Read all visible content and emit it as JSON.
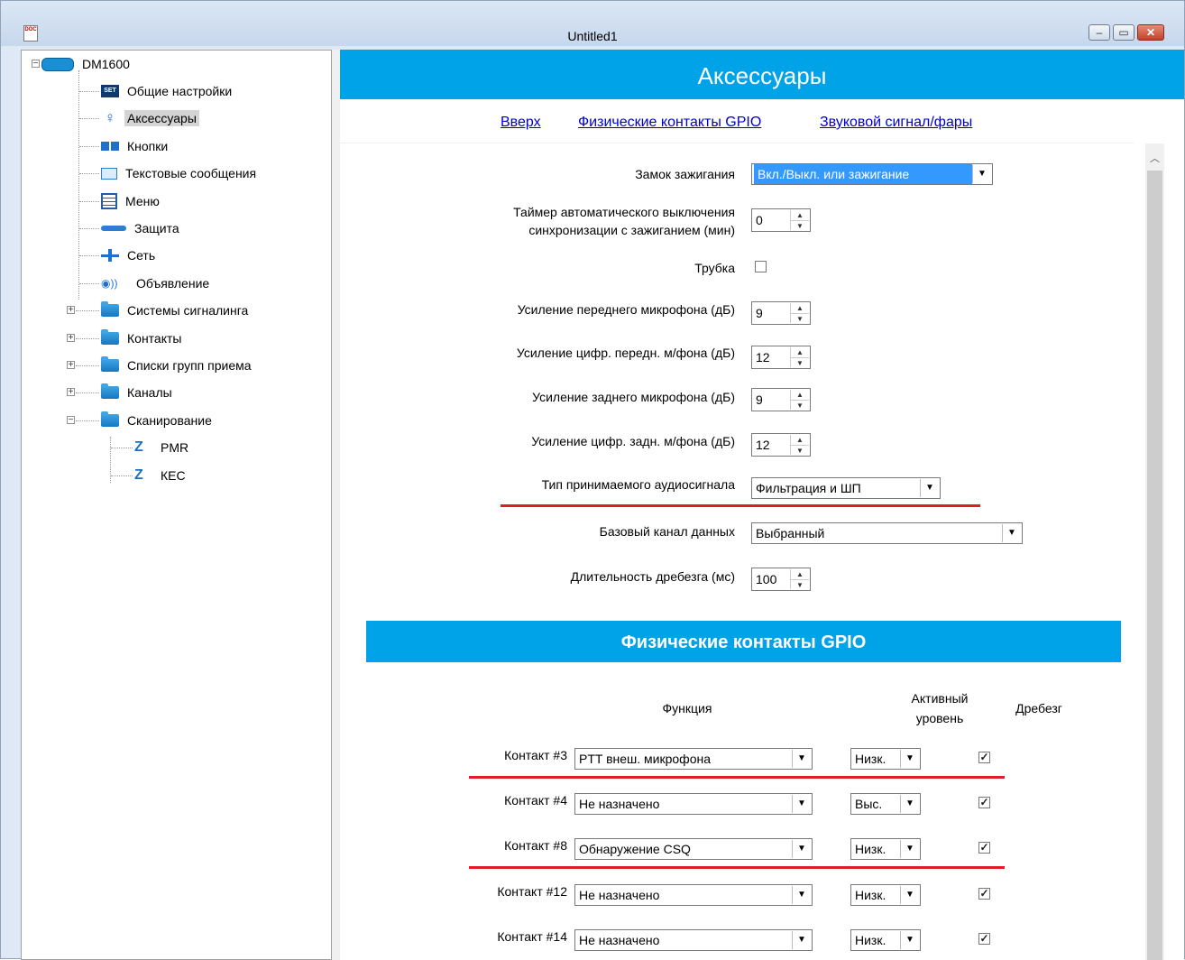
{
  "window": {
    "title": "Untitled1",
    "app_icon_text": "DOC",
    "buttons": [
      "minimize",
      "maximize",
      "close"
    ]
  },
  "tree": {
    "root": "DM1600",
    "items": [
      {
        "label": "Общие настройки",
        "icon": "settings-icon",
        "selected": false
      },
      {
        "label": "Аксессуары",
        "icon": "accessories-icon",
        "selected": true
      },
      {
        "label": "Кнопки",
        "icon": "buttons-icon",
        "selected": false
      },
      {
        "label": "Текстовые сообщения",
        "icon": "envelope-icon",
        "selected": false
      },
      {
        "label": "Меню",
        "icon": "menu-icon",
        "selected": false
      },
      {
        "label": "Защита",
        "icon": "key-icon",
        "selected": false
      },
      {
        "label": "Сеть",
        "icon": "network-icon",
        "selected": false
      },
      {
        "label": "Объявление",
        "icon": "broadcast-icon",
        "selected": false
      },
      {
        "label": "Системы сигналинга",
        "icon": "folder-icon",
        "expandable": true
      },
      {
        "label": "Контакты",
        "icon": "folder-icon",
        "expandable": true
      },
      {
        "label": "Списки групп приема",
        "icon": "folder-icon",
        "expandable": true
      },
      {
        "label": "Каналы",
        "icon": "folder-icon",
        "expandable": true
      },
      {
        "label": "Сканирование",
        "icon": "folder-open-icon",
        "expandable": true,
        "expanded": true
      },
      {
        "label": "PMR",
        "icon": "scan-z-icon",
        "child": true
      },
      {
        "label": "КЕС",
        "icon": "scan-z-icon",
        "child": true
      }
    ]
  },
  "main": {
    "title": "Аксессуары",
    "links": [
      "Вверх",
      "Физические контакты GPIO",
      "Звуковой сигнал/фары"
    ],
    "fields": {
      "ignition_lock": {
        "label": "Замок зажигания",
        "value": "Вкл./Выкл. или зажигание"
      },
      "auto_off_timer": {
        "label_line1": "Таймер автоматического выключения",
        "label_line2": "синхронизации с зажиганием (мин)",
        "value": "0"
      },
      "handset": {
        "label": "Трубка",
        "checked": false
      },
      "front_mic_gain": {
        "label": "Усиление переднего микрофона (дБ)",
        "value": "9"
      },
      "digital_front_mic_gain": {
        "label": "Усиление цифр. передн. м/фона (дБ)",
        "value": "12"
      },
      "rear_mic_gain": {
        "label": "Усиление заднего микрофона (дБ)",
        "value": "9"
      },
      "digital_rear_mic_gain": {
        "label": "Усиление цифр. задн. м/фона (дБ)",
        "value": "12"
      },
      "rx_audio_type": {
        "label": "Тип принимаемого аудиосигнала",
        "value": "Фильтрация и ШП"
      },
      "base_data_channel": {
        "label": "Базовый канал данных",
        "value": "Выбранный"
      },
      "debounce_duration": {
        "label": "Длительность дребезга (мс)",
        "value": "100"
      }
    },
    "gpio": {
      "title": "Физические контакты GPIO",
      "headers": {
        "function": "Функция",
        "active_level_1": "Активный",
        "active_level_2": "уровень",
        "debounce": "Дребезг"
      },
      "rows": [
        {
          "label": "Контакт #3",
          "function": "PTT внеш. микрофона",
          "level": "Низк.",
          "debounce": true
        },
        {
          "label": "Контакт #4",
          "function": "Не назначено",
          "level": "Выс.",
          "debounce": true
        },
        {
          "label": "Контакт #8",
          "function": "Обнаружение CSQ",
          "level": "Низк.",
          "debounce": true
        },
        {
          "label": "Контакт #12",
          "function": "Не назначено",
          "level": "Низк.",
          "debounce": true
        },
        {
          "label": "Контакт #14",
          "function": "Не назначено",
          "level": "Низк.",
          "debounce": true
        }
      ]
    }
  }
}
